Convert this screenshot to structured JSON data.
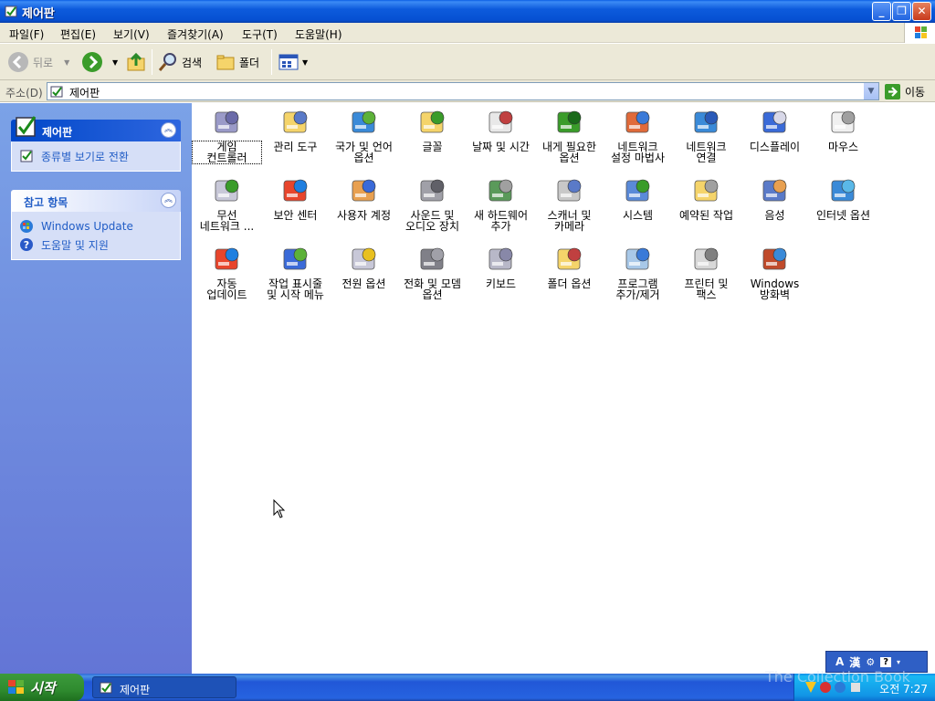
{
  "window": {
    "title": "제어판"
  },
  "menubar": {
    "items": [
      "파일(F)",
      "편집(E)",
      "보기(V)",
      "즐겨찾기(A)",
      "도구(T)",
      "도움말(H)"
    ]
  },
  "toolbar": {
    "back_label": "뒤로",
    "search_label": "검색",
    "folders_label": "폴더"
  },
  "address": {
    "label": "주소(D)",
    "value": "제어판",
    "go_label": "이동"
  },
  "sidebar": {
    "panel1": {
      "title": "제어판",
      "links": [
        "종류별 보기로 전환"
      ]
    },
    "panel2": {
      "title": "참고 항목",
      "links": [
        "Windows Update",
        "도움말 및 지원"
      ]
    }
  },
  "content": {
    "items": [
      {
        "label": "게임\n컨트롤러",
        "icon": "game-controller-icon"
      },
      {
        "label": "관리 도구",
        "icon": "admin-tools-icon"
      },
      {
        "label": "국가 및 언어\n옵션",
        "icon": "globe-icon"
      },
      {
        "label": "글꼴",
        "icon": "fonts-folder-icon"
      },
      {
        "label": "날짜 및 시간",
        "icon": "clock-icon"
      },
      {
        "label": "내게 필요한\n옵션",
        "icon": "accessibility-icon"
      },
      {
        "label": "네트워크\n설정 마법사",
        "icon": "network-house-icon"
      },
      {
        "label": "네트워크\n연결",
        "icon": "network-globe-icon"
      },
      {
        "label": "디스플레이",
        "icon": "display-icon"
      },
      {
        "label": "마우스",
        "icon": "mouse-icon"
      },
      {
        "label": "무선\n네트워크 ...",
        "icon": "wireless-icon"
      },
      {
        "label": "보안 센터",
        "icon": "shield-icon"
      },
      {
        "label": "사용자 계정",
        "icon": "users-icon"
      },
      {
        "label": "사운드 및\n오디오 장치",
        "icon": "speaker-icon"
      },
      {
        "label": "새 하드웨어\n추가",
        "icon": "hardware-icon"
      },
      {
        "label": "스캐너 및\n카메라",
        "icon": "scanner-icon"
      },
      {
        "label": "시스템",
        "icon": "system-icon"
      },
      {
        "label": "예약된 작업",
        "icon": "scheduled-tasks-icon"
      },
      {
        "label": "음성",
        "icon": "speech-icon"
      },
      {
        "label": "인터넷 옵션",
        "icon": "internet-icon"
      },
      {
        "label": "자동\n업데이트",
        "icon": "windows-flag-icon"
      },
      {
        "label": "작업 표시줄\n및 시작 메뉴",
        "icon": "taskbar-icon"
      },
      {
        "label": "전원 옵션",
        "icon": "power-icon"
      },
      {
        "label": "전화 및 모뎀\n옵션",
        "icon": "phone-icon"
      },
      {
        "label": "키보드",
        "icon": "keyboard-icon"
      },
      {
        "label": "폴더 옵션",
        "icon": "folder-options-icon"
      },
      {
        "label": "프로그램\n추가/제거",
        "icon": "add-remove-icon"
      },
      {
        "label": "프린터 및\n팩스",
        "icon": "printer-icon"
      },
      {
        "label": "Windows\n방화벽",
        "icon": "firewall-icon"
      }
    ]
  },
  "taskbar": {
    "start_label": "시작",
    "task_label": "제어판",
    "clock": "오전 7:27"
  },
  "langbar": {
    "a": "A",
    "han": "漢"
  },
  "watermark": "The Collection Book"
}
